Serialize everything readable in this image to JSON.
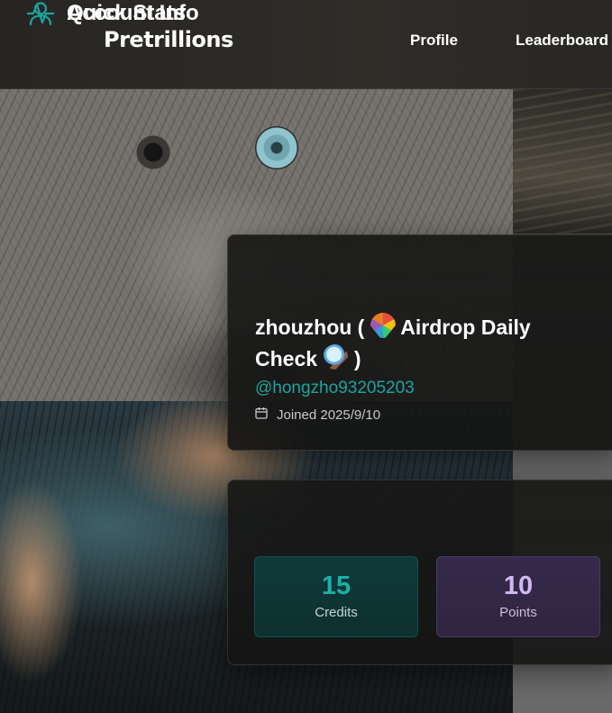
{
  "header": {
    "brand": "Pretrillions",
    "nav": [
      {
        "label": "Profile"
      },
      {
        "label": "Leaderboard"
      }
    ]
  },
  "account": {
    "title": "Account Info",
    "icon": "user-icon",
    "display_name_prefix": "zhouzhou (",
    "display_name_middle": "Airdrop Daily Check",
    "display_name_suffix": ")",
    "handle": "@hongzho93205203",
    "joined_icon": "calendar-icon",
    "joined": "Joined 2025/9/10"
  },
  "stats": {
    "title": "Quick Stats",
    "icon": "activity-icon",
    "items": [
      {
        "value": "15",
        "label": "Credits",
        "color": "#19b0a8"
      },
      {
        "value": "10",
        "label": "Points",
        "color": "#d2b8f5"
      }
    ]
  },
  "colors": {
    "accent_teal": "#19a5a0",
    "accent_purple": "#d2b8f5"
  }
}
